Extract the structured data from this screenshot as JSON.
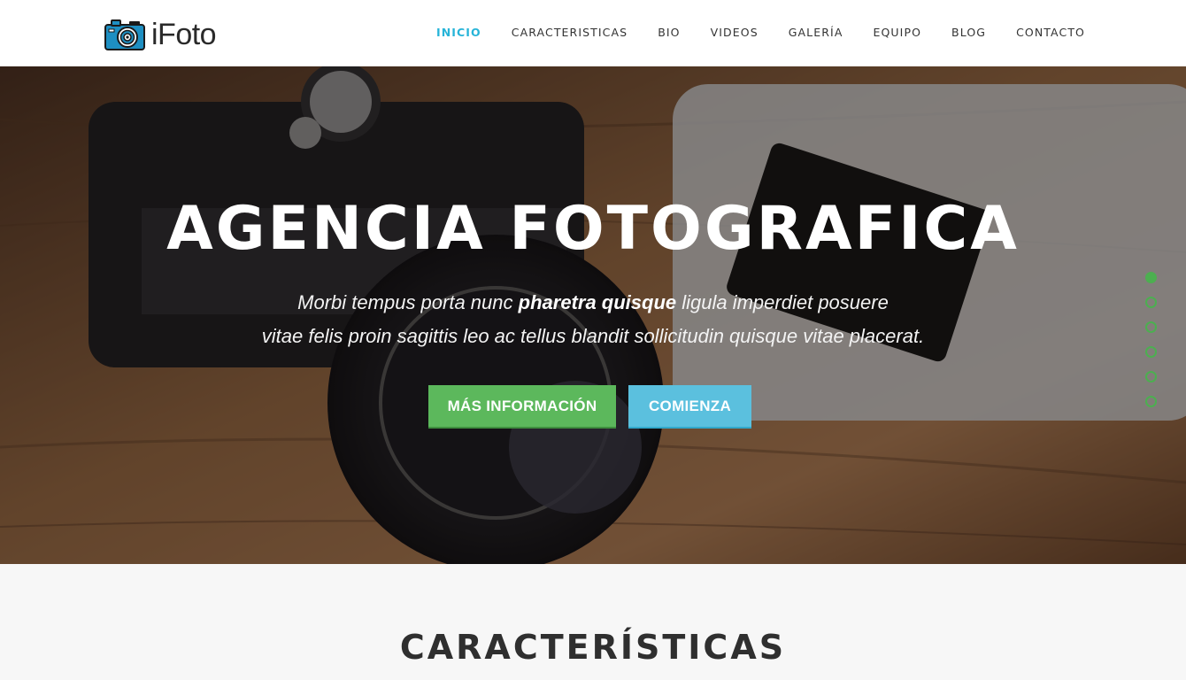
{
  "header": {
    "logo_text": "iFoto",
    "logo_icon": "camera-icon",
    "nav": [
      {
        "label": "INICIO",
        "active": true
      },
      {
        "label": "CARACTERISTICAS",
        "active": false
      },
      {
        "label": "BIO",
        "active": false
      },
      {
        "label": "VIDEOS",
        "active": false
      },
      {
        "label": "GALERÍA",
        "active": false
      },
      {
        "label": "EQUIPO",
        "active": false
      },
      {
        "label": "BLOG",
        "active": false
      },
      {
        "label": "CONTACTO",
        "active": false
      }
    ]
  },
  "hero": {
    "title": "AGENCIA FOTOGRAFICA",
    "subtitle_part1": "Morbi tempus porta nunc ",
    "subtitle_bold": "pharetra quisque",
    "subtitle_part2": " ligula imperdiet posuere",
    "subtitle_line2": "vitae felis proin sagittis leo ac tellus blandit sollicitudin quisque vitae placerat.",
    "button_info": "MÁS INFORMACIÓN",
    "button_start": "COMIENZA",
    "slide_count": 6,
    "active_slide": 1
  },
  "features": {
    "title": "CARACTERÍSTICAS"
  },
  "colors": {
    "nav_active": "#27b4d8",
    "btn_green": "#5cb85c",
    "btn_blue": "#5bc0de",
    "dot_green": "#4caf50"
  }
}
